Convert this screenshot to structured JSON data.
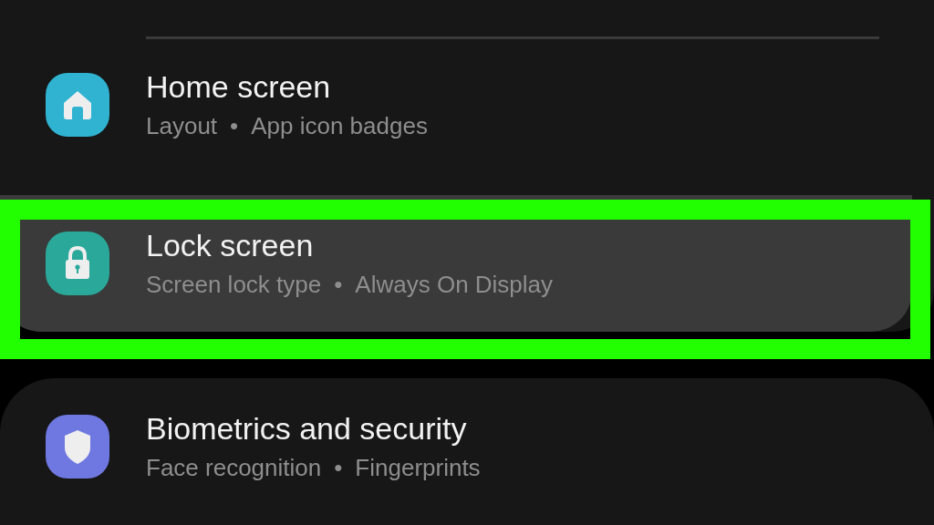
{
  "separator": "•",
  "sections": [
    {
      "items": [
        {
          "kind": "home",
          "title": "Home screen",
          "subtitle": [
            "Layout",
            "App icon badges"
          ],
          "selected": false,
          "highlighted": false
        },
        {
          "kind": "lock",
          "title": "Lock screen",
          "subtitle": [
            "Screen lock type",
            "Always On Display"
          ],
          "selected": true,
          "highlighted": true
        }
      ]
    },
    {
      "items": [
        {
          "kind": "shield",
          "title": "Biometrics and security",
          "subtitle": [
            "Face recognition",
            "Fingerprints"
          ],
          "selected": false,
          "highlighted": false
        }
      ]
    }
  ]
}
